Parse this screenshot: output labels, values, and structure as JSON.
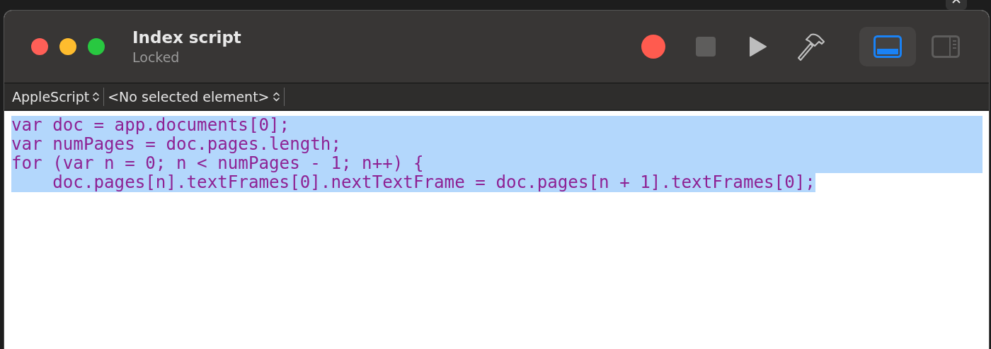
{
  "window": {
    "title": "Index script",
    "subtitle": "Locked"
  },
  "view_toggles": [
    {
      "selected": true
    },
    {
      "selected": false
    }
  ],
  "navigation_bar": {
    "language": "AppleScript",
    "element": "<No selected element>"
  },
  "editor": {
    "selected": true,
    "lines": [
      "var doc = app.documents[0];",
      "var numPages = doc.pages.length;",
      "for (var n = 0; n < numPages - 1; n++) {",
      "    doc.pages[n].textFrames[0].nextTextFrame = doc.pages[n + 1].textFrames[0];"
    ]
  }
}
